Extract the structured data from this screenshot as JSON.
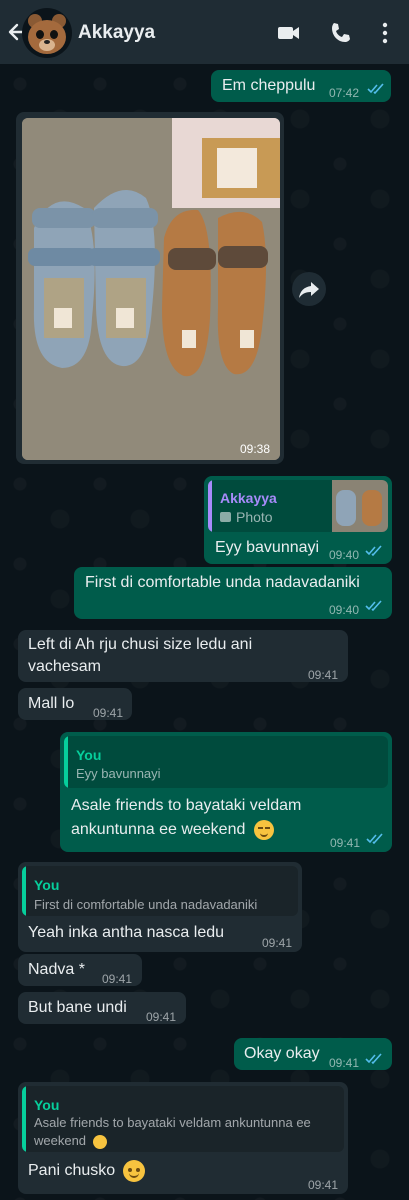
{
  "header": {
    "contact_name": "Akkayya",
    "icons": [
      "back-arrow-icon",
      "avatar",
      "video-call-icon",
      "phone-call-icon",
      "more-options-icon"
    ]
  },
  "colors": {
    "incoming": "#202c33",
    "outgoing": "#005c4b",
    "read_tick": "#53bdeb",
    "header": "#1f2c34",
    "quote_you": "#06cf9c",
    "quote_contact": "#a78bfa"
  },
  "messages": [
    {
      "dir": "out",
      "text": "Em cheppulu",
      "time": "07:42"
    },
    {
      "dir": "in",
      "type": "photo",
      "time": "09:38"
    },
    {
      "dir": "out",
      "quote_name": "Akkayya",
      "quote_text": "Photo",
      "text": "Eyy bavunnayi",
      "time": "09:40"
    },
    {
      "dir": "out",
      "text": "First di comfortable unda nadavadaniki",
      "time": "09:40"
    },
    {
      "dir": "in",
      "text": "Left di Ah rju chusi size ledu ani vachesam",
      "time": "09:41"
    },
    {
      "dir": "in",
      "text": "Mall lo",
      "time": "09:41"
    },
    {
      "dir": "out",
      "quote_name": "You",
      "quote_text": "Eyy bavunnayi",
      "text": "Asale friends to bayataki veldam ankuntunna ee weekend",
      "time": "09:41"
    },
    {
      "dir": "in",
      "quote_name": "You",
      "quote_text": "First di comfortable unda nadavadaniki",
      "text": "Yeah inka antha nasca ledu",
      "time": "09:41"
    },
    {
      "dir": "in",
      "text": "Nadva *",
      "time": "09:41"
    },
    {
      "dir": "in",
      "text": "But bane undi",
      "time": "09:41"
    },
    {
      "dir": "out",
      "text": "Okay okay",
      "time": "09:41"
    },
    {
      "dir": "in",
      "quote_name": "You",
      "quote_text": "Asale friends to bayataki veldam ankuntunna ee weekend",
      "text": "Pani chusko",
      "time": "09:41"
    }
  ]
}
